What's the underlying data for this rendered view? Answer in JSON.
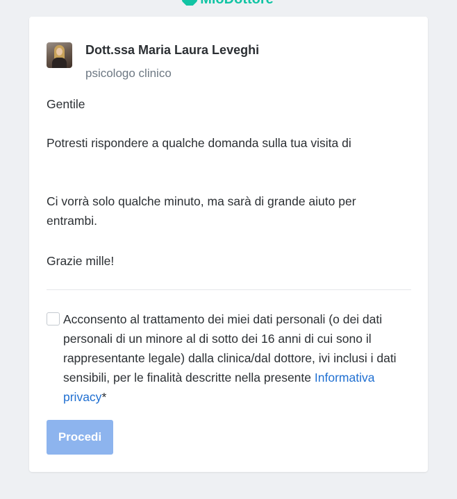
{
  "header": {
    "logo_text": "MioDottore"
  },
  "doctor": {
    "name": "Dott.ssa Maria Laura Leveghi",
    "specialty": "psicologo clinico"
  },
  "message": {
    "greeting": "Gentile",
    "question": "Potresti rispondere a qualche domanda sulla tua visita di",
    "note": "Ci vorrà solo qualche minuto, ma sarà di grande aiuto per entrambi.",
    "thanks": "Grazie mille!"
  },
  "consent": {
    "checked": false,
    "text": "Acconsento al trattamento dei miei dati personali (o dei dati personali di un minore al di sotto dei 16 anni di cui sono il rappresentante legale) dalla clinica/dal dottore, ivi inclusi i dati sensibili, per le finalità descritte nella presente ",
    "link_label": "Informativa privacy",
    "required_mark": "*"
  },
  "actions": {
    "submit_label": "Procedi"
  },
  "colors": {
    "brand": "#12c4a4",
    "link": "#1f6fd1",
    "button_disabled": "#8db4ee",
    "page_background": "#eef0f3"
  }
}
